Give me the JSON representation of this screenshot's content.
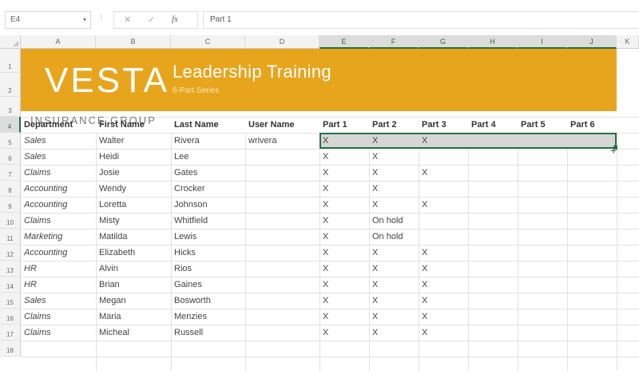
{
  "formula_bar": {
    "name_box": "E4",
    "dropdown_glyph": "▾",
    "separator_glyph": "⁝",
    "cancel_glyph": "✕",
    "enter_glyph": "✓",
    "fx_glyph": "fx",
    "value": "Part 1"
  },
  "columns": [
    {
      "label": "A",
      "selected": false
    },
    {
      "label": "B",
      "selected": false
    },
    {
      "label": "C",
      "selected": false
    },
    {
      "label": "D",
      "selected": false
    },
    {
      "label": "E",
      "selected": true
    },
    {
      "label": "F",
      "selected": true
    },
    {
      "label": "G",
      "selected": true
    },
    {
      "label": "H",
      "selected": true
    },
    {
      "label": "I",
      "selected": true
    },
    {
      "label": "J",
      "selected": true
    },
    {
      "label": "K",
      "selected": false
    }
  ],
  "rows": [
    "1",
    "2",
    "3",
    "4",
    "5",
    "6",
    "7",
    "8",
    "9",
    "10",
    "11",
    "12",
    "13",
    "14",
    "15",
    "16",
    "17",
    "18"
  ],
  "selected_row": "4",
  "banner": {
    "logo": "VESTA",
    "title": "Leadership Training",
    "subtitle": "6-Part Series",
    "brand_color": "#e7a51e"
  },
  "insurance_group": "INSURANCE GROUP",
  "table": {
    "headers": [
      "Department",
      "First Name",
      "Last Name",
      "User Name",
      "Part 1",
      "Part 2",
      "Part 3",
      "Part 4",
      "Part 5",
      "Part 6"
    ],
    "rows": [
      [
        "Sales",
        "Walter",
        "Rivera",
        "wrivera",
        "X",
        "X",
        "X",
        "",
        "",
        ""
      ],
      [
        "Sales",
        "Heidi",
        "Lee",
        "",
        "X",
        "X",
        "",
        "",
        "",
        ""
      ],
      [
        "Claims",
        "Josie",
        "Gates",
        "",
        "X",
        "X",
        "X",
        "",
        "",
        ""
      ],
      [
        "Accounting",
        "Wendy",
        "Crocker",
        "",
        "X",
        "X",
        "",
        "",
        "",
        ""
      ],
      [
        "Accounting",
        "Loretta",
        "Johnson",
        "",
        "X",
        "X",
        "X",
        "",
        "",
        ""
      ],
      [
        "Claims",
        "Misty",
        "Whitfield",
        "",
        "X",
        "On hold",
        "",
        "",
        "",
        ""
      ],
      [
        "Marketing",
        "Matilda",
        "Lewis",
        "",
        "X",
        "On hold",
        "",
        "",
        "",
        ""
      ],
      [
        "Accounting",
        "Elizabeth",
        "Hicks",
        "",
        "X",
        "X",
        "X",
        "",
        "",
        ""
      ],
      [
        "HR",
        "Alvin",
        "Rios",
        "",
        "X",
        "X",
        "X",
        "",
        "",
        ""
      ],
      [
        "HR",
        "Brian",
        "Gaines",
        "",
        "X",
        "X",
        "X",
        "",
        "",
        ""
      ],
      [
        "Sales",
        "Megan",
        "Bosworth",
        "",
        "X",
        "X",
        "X",
        "",
        "",
        ""
      ],
      [
        "Claims",
        "Maria",
        "Menzies",
        "",
        "X",
        "X",
        "X",
        "",
        "",
        ""
      ],
      [
        "Claims",
        "Micheal",
        "Russell",
        "",
        "X",
        "X",
        "X",
        "",
        "",
        ""
      ]
    ]
  },
  "accent_color": "#217346",
  "cursor_glyph": "+"
}
